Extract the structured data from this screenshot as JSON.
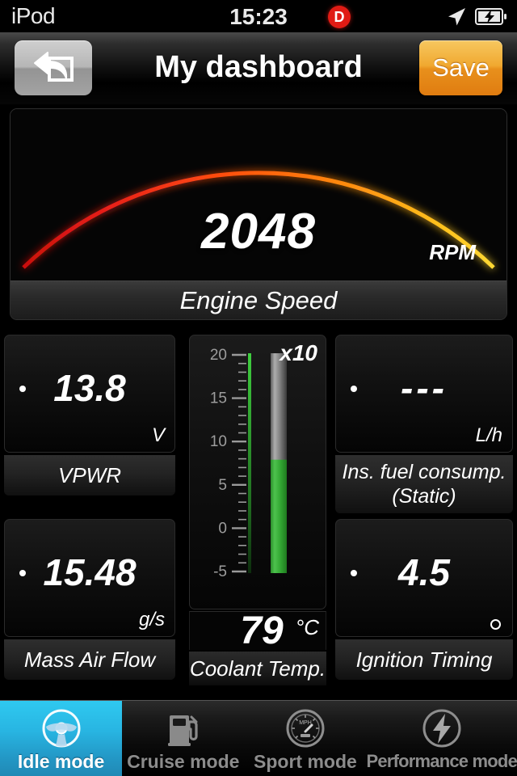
{
  "status_bar": {
    "carrier": "iPod",
    "time": "15:23",
    "badge": "D",
    "badge_color": "#e01b14",
    "location_icon": "location-arrow-icon",
    "battery_icon": "battery-charging-icon"
  },
  "nav_bar": {
    "back_icon": "undo-arrow-icon",
    "title": "My dashboard",
    "save_label": "Save",
    "save_color": "#ed9a22"
  },
  "main_gauge": {
    "value": "2048",
    "unit": "RPM",
    "label": "Engine Speed",
    "lit_fraction": 0.25,
    "segment_count": 64,
    "arc_colors": [
      "#e8100f",
      "#ff5a12",
      "#ff8a12",
      "#ffc21f"
    ]
  },
  "tiles": [
    {
      "name": "vpwr",
      "value": "13.8",
      "unit": "V",
      "label": "VPWR",
      "marker": "dot"
    },
    {
      "name": "instant-fuel-consumption",
      "value": "---",
      "unit": "L/h",
      "label": "Ins. fuel consump.",
      "label2": "(Static)",
      "marker": "dot"
    },
    {
      "name": "mass-air-flow",
      "value": "15.48",
      "unit": "g/s",
      "label": "Mass Air Flow",
      "marker": "dot"
    },
    {
      "name": "ignition-timing",
      "value": "4.5",
      "unit": "°",
      "label": "Ignition Timing",
      "marker": "dot-and-circle"
    }
  ],
  "coolant": {
    "multiplier": "x10",
    "value": "79",
    "unit": "°C",
    "label": "Coolant Temp.",
    "bar_color": "#3aaf3a",
    "scale_ticks": [
      "20",
      "15",
      "10",
      "5",
      "0",
      "-5"
    ],
    "scale_min": -5,
    "scale_max": 20,
    "fill_value": 7.9
  },
  "tab_bar": {
    "active_index": 0,
    "active_color": "#29c5ef",
    "tabs": [
      {
        "label": "Idle mode",
        "icon": "steering-wheel-icon"
      },
      {
        "label": "Cruise mode",
        "icon": "fuel-pump-icon"
      },
      {
        "label": "Sport mode",
        "icon": "speedometer-icon"
      },
      {
        "label": "Performance mode",
        "icon": "lightning-bolt-icon"
      }
    ]
  },
  "chart_data": {
    "type": "bar",
    "title": "Engine Speed",
    "ylabel": "RPM",
    "categories": [
      "Engine Speed"
    ],
    "values": [
      2048
    ],
    "gauge_fill_ratio": 0.25,
    "secondary": {
      "type": "bar",
      "title": "Coolant Temp.",
      "ylabel": "°C",
      "values": [
        79
      ],
      "ylim": [
        -50,
        200
      ],
      "tick_labels": [
        "20",
        "15",
        "10",
        "5",
        "0",
        "-5"
      ],
      "tick_multiplier": 10
    }
  }
}
